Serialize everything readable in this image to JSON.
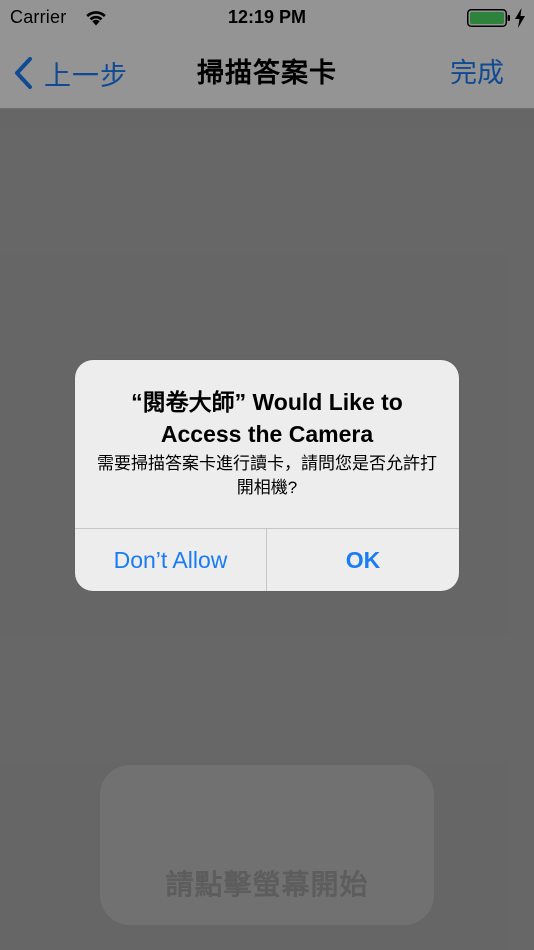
{
  "status_bar": {
    "carrier": "Carrier",
    "time": "12:19 PM",
    "battery_level_fraction": 1.0,
    "battery_color": "#4cd964",
    "icons": [
      "wifi-icon",
      "battery-icon",
      "charging-icon"
    ]
  },
  "nav": {
    "back_label": "上一步",
    "title": "掃描答案卡",
    "done_label": "完成",
    "accent_color": "#1a7cf5"
  },
  "content": {
    "start_hint": "請點擊螢幕開始"
  },
  "alert": {
    "title": "“閱卷大師” Would Like to Access the Camera",
    "message": "需要掃描答案卡進行讀卡，請問您是否允許打開相機?",
    "deny_button": "Don’t Allow",
    "ok_button": "OK"
  }
}
